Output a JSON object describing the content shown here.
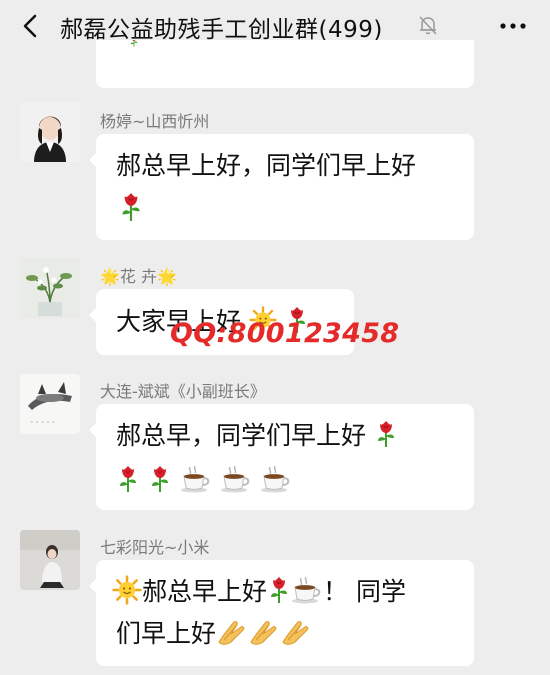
{
  "header": {
    "title": "郝磊公益助残手工创业群(499)"
  },
  "messages": [
    {
      "sender": "杨婷~山西忻州",
      "lines": [
        "郝总早上好，同学们早上好"
      ]
    },
    {
      "sender_star_left": "🌟",
      "sender": "花 卉",
      "sender_star_right": "🌟",
      "text": "大家早上好"
    },
    {
      "sender": "大连-斌斌《小副班长》",
      "line1": "郝总早，同学们早上好"
    },
    {
      "sender": "七彩阳光~小米",
      "text_a": "郝总早上好",
      "text_b": "！ 同学",
      "line2": "们早上好"
    }
  ],
  "watermark": "QQ:800123458",
  "icons": {
    "back": "chevron-left-icon",
    "mute": "bell-off-icon",
    "more": "more-icon",
    "emoji_rose": "rose",
    "emoji_sun": "sun",
    "emoji_coffee": "coffee",
    "emoji_pray": "pray-hands"
  },
  "colors": {
    "background": "#ededed",
    "bubble": "#ffffff",
    "sender_name": "#7a7a7a",
    "watermark": "#e52a2a"
  }
}
